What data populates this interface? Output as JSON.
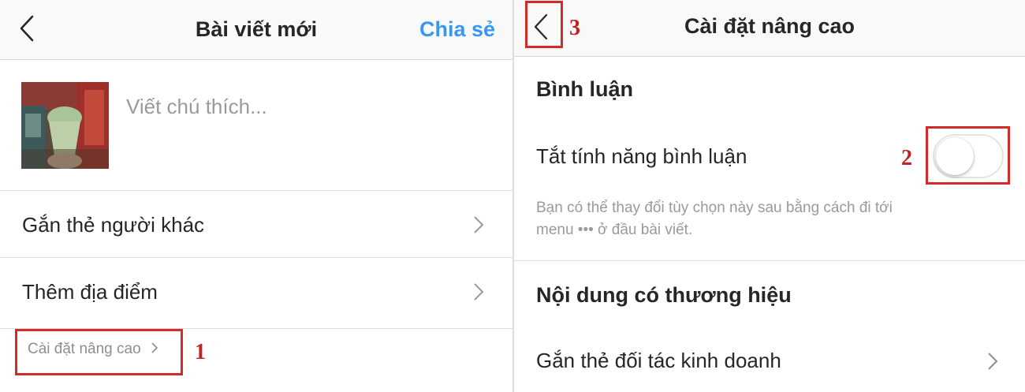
{
  "left": {
    "header": {
      "title": "Bài viết mới",
      "share_label": "Chia sẻ"
    },
    "caption": {
      "placeholder": "Viết chú thích..."
    },
    "rows": [
      {
        "label": "Gắn thẻ người khác"
      },
      {
        "label": "Thêm địa điểm"
      }
    ],
    "advanced": {
      "label": "Cài đặt nâng cao"
    }
  },
  "right": {
    "header": {
      "title": "Cài đặt nâng cao"
    },
    "comments": {
      "section_title": "Bình luận",
      "toggle_label": "Tắt tính năng bình luận",
      "toggle_on": false,
      "help_line1": "Bạn có thể thay đổi tùy chọn này sau bằng cách đi tới",
      "help_line2": "menu ••• ở đầu bài viết."
    },
    "branded": {
      "section_title": "Nội dung có thương hiệu",
      "row_label": "Gắn thẻ đối tác kinh doanh"
    }
  },
  "annotations": [
    "1",
    "2",
    "3"
  ],
  "colors": {
    "accent": "#3897f0",
    "annotation": "#d42a2a",
    "text": "#262626",
    "muted": "#8e8e8e"
  }
}
